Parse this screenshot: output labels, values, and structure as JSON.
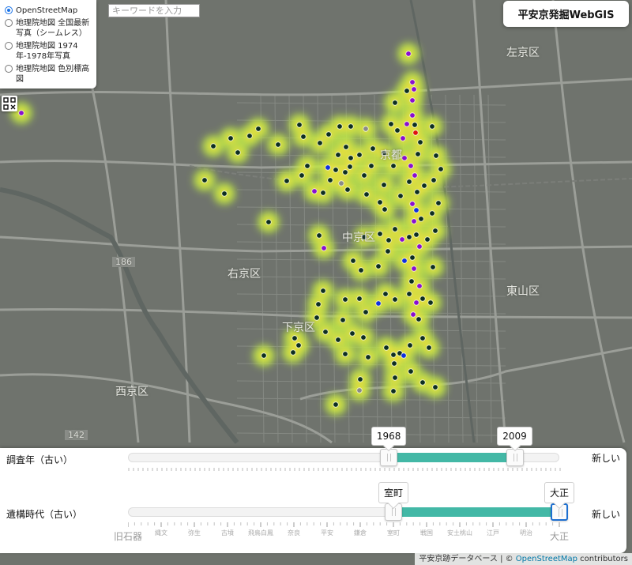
{
  "layer_control": {
    "options": [
      {
        "label": "OpenStreetMap",
        "selected": true
      },
      {
        "label": "地理院地図 全国最新写真（シームレス）",
        "selected": false
      },
      {
        "label": "地理院地図 1974年-1978年写真",
        "selected": false
      },
      {
        "label": "地理院地図 色別標高図",
        "selected": false
      }
    ]
  },
  "search": {
    "placeholder": "キーワードを入力",
    "value": ""
  },
  "title": "平安京発掘WebGIS",
  "map": {
    "place_labels": {
      "sakyo": "左京区",
      "ukyo": "右京区",
      "nakagyo": "中京区",
      "shimogyo": "下京区",
      "higashiyama": "東山区",
      "nishikyo": "西京区",
      "kyoto": "京都"
    },
    "road_numbers": {
      "r186": "186",
      "r142": "142"
    },
    "point_colors": {
      "site": "#0e2e22",
      "purple": "#8a0fd0",
      "blue": "#1030e0",
      "red": "#e01010",
      "gray": "#8a8a8a",
      "heat_core": "#f4e13a",
      "heat_outer": "#b8e84a"
    }
  },
  "year_slider": {
    "label": "調査年（古い）",
    "newer_label": "新しい",
    "min_value": "1968",
    "max_value": "2009",
    "range_fraction": [
      0.605,
      0.897
    ]
  },
  "era_slider": {
    "label": "遺構時代（古い）",
    "newer_label": "新しい",
    "min_value": "室町",
    "max_value": "大正",
    "eras": [
      "旧石器",
      "縄文",
      "弥生",
      "古墳",
      "飛鳥白鳳",
      "奈良",
      "平安",
      "鎌倉",
      "室町",
      "戦国",
      "安土桃山",
      "江戸",
      "明治",
      "大正"
    ],
    "selected_index": [
      8,
      13
    ]
  },
  "attribution": {
    "source": "平安京跡データベース",
    "separator": " | © ",
    "osm": "OpenStreetMap",
    "suffix": " contributors"
  }
}
